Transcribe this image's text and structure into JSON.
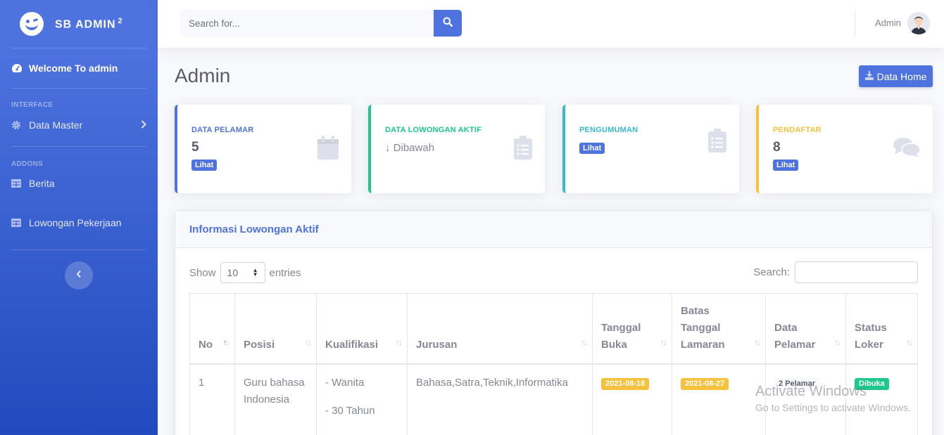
{
  "sidebar": {
    "brand": "SB ADMIN",
    "brand_sup": "2",
    "welcome": "Welcome To admin",
    "heading_interface": "INTERFACE",
    "data_master": "Data Master",
    "heading_addons": "ADDONS",
    "berita": "Berita",
    "lowongan": "Lowongan Pekerjaan"
  },
  "topbar": {
    "search_placeholder": "Search for...",
    "user_name": "Admin"
  },
  "page": {
    "title": "Admin",
    "home_button": "Data Home"
  },
  "cards": [
    {
      "label": "DATA PELAMAR",
      "value": "5",
      "link": "Lihat",
      "color": "#4e73df",
      "icon": "calendar-icon"
    },
    {
      "label": "DATA LOWONGAN AKTIF",
      "value": "Dibawah",
      "color": "#1cc88a",
      "icon": "clipboard-list-icon"
    },
    {
      "label": "PENGUMUMAN",
      "link": "Lihat",
      "color": "#36b9cc",
      "icon": "clipboard-list-icon"
    },
    {
      "label": "PENDAFTAR",
      "value": "8",
      "link": "Lihat",
      "color": "#f6c23e",
      "icon": "comments-icon"
    }
  ],
  "table_card": {
    "title": "Informasi Lowongan Aktif",
    "show_label": "Show",
    "entries_value": "10",
    "entries_label": "entries",
    "search_label": "Search:",
    "columns": [
      "No",
      "Posisi",
      "Kualifikasi",
      "Jurusan",
      "Tanggal Buka",
      "Batas Tanggal Lamaran",
      "Data Pelamar",
      "Status Loker"
    ],
    "rows": [
      {
        "no": "1",
        "posisi": "Guru bahasa Indonesia",
        "kualifikasi": [
          "- Wanita",
          "- 30 Tahun",
          "-"
        ],
        "jurusan": "Bahasa,Satra,Teknik,Informatika",
        "tanggal_buka": "2021-08-18",
        "batas": "2021-08-27",
        "pelamar": "2 Pelamar",
        "status": "Dibuka"
      }
    ]
  },
  "watermark": {
    "line1": "Activate Windows",
    "line2": "Go to Settings to activate Windows."
  },
  "colors": {
    "primary": "#4e73df",
    "success": "#1cc88a",
    "info": "#36b9cc",
    "warning": "#f6c23e"
  }
}
